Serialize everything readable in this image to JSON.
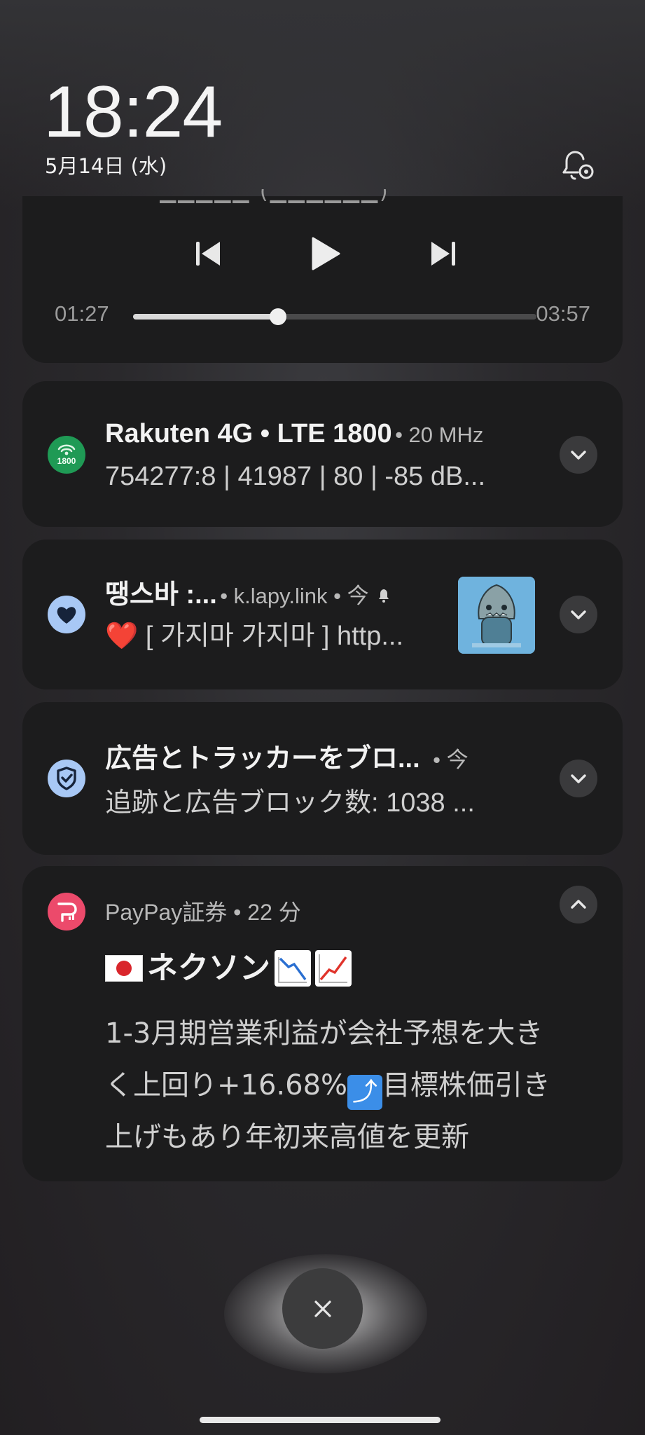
{
  "lockscreen": {
    "time": "18:24",
    "date": "5月14日 (水)"
  },
  "media": {
    "elapsed": "01:27",
    "duration": "03:57",
    "progress": 0.36
  },
  "notifications": [
    {
      "app_title": "Rakuten 4G • LTE 1800",
      "meta": "• 20 MHz",
      "body": "754277:8 | 41987 | 80 | -85 dB...",
      "icon_label": "1800",
      "icon_color": "#1f9a55"
    },
    {
      "app_title": "땡스바 :...",
      "meta": "• k.lapy.link • 今",
      "body_prefix": "❤️",
      "body": " [ 가지마 가지마 ] http...",
      "icon_color": "#a8c8f5"
    },
    {
      "app_title": "広告とトラッカーをブロ...",
      "meta": "• 今",
      "body": "追跡と広告ブロック数: 1038 ...",
      "icon_color": "#a8c8f5"
    },
    {
      "app_name": "PayPay証券 • 22 分",
      "headline": "ネクソン",
      "body_lines": [
        "1-3月期営業利益が会社予想を大き",
        "く上回り+16.68%",
        "目標株価引き",
        "上げもあり年初来高値を更新"
      ],
      "icon_color": "#ec4a6b"
    }
  ],
  "colors": {
    "card_bg": "#1c1c1d",
    "accent_green": "#1f9a55",
    "accent_blue": "#a8c8f5",
    "accent_pink": "#ec4a6b"
  }
}
